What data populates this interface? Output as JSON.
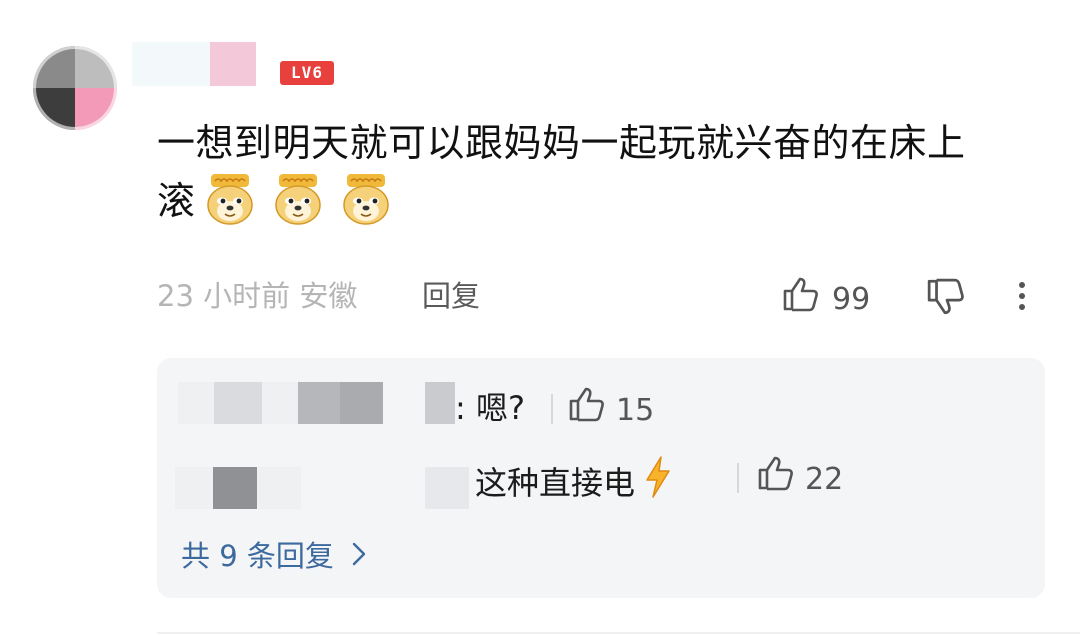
{
  "comment": {
    "level_badge": "LV6",
    "text_line1": "一想到明天就可以跟妈妈一起玩就兴奋的在床上",
    "text_line2": "滚",
    "emojis": [
      "doge-emoji",
      "doge-emoji",
      "doge-emoji"
    ],
    "time_location": "23 小时前 安徽",
    "reply_label": "回复",
    "like_count": "99"
  },
  "replies": [
    {
      "text": ": 嗯?",
      "like_count": "15"
    },
    {
      "text": "这种直接电",
      "emoji": "lightning-emoji",
      "like_count": "22"
    }
  ],
  "more_replies_label": "共 9 条回复",
  "colors": {
    "level_badge": "#e8413d",
    "link_blue": "#3d6a9e",
    "panel_bg": "#f4f5f7",
    "meta_gray": "#b5b5b5"
  }
}
